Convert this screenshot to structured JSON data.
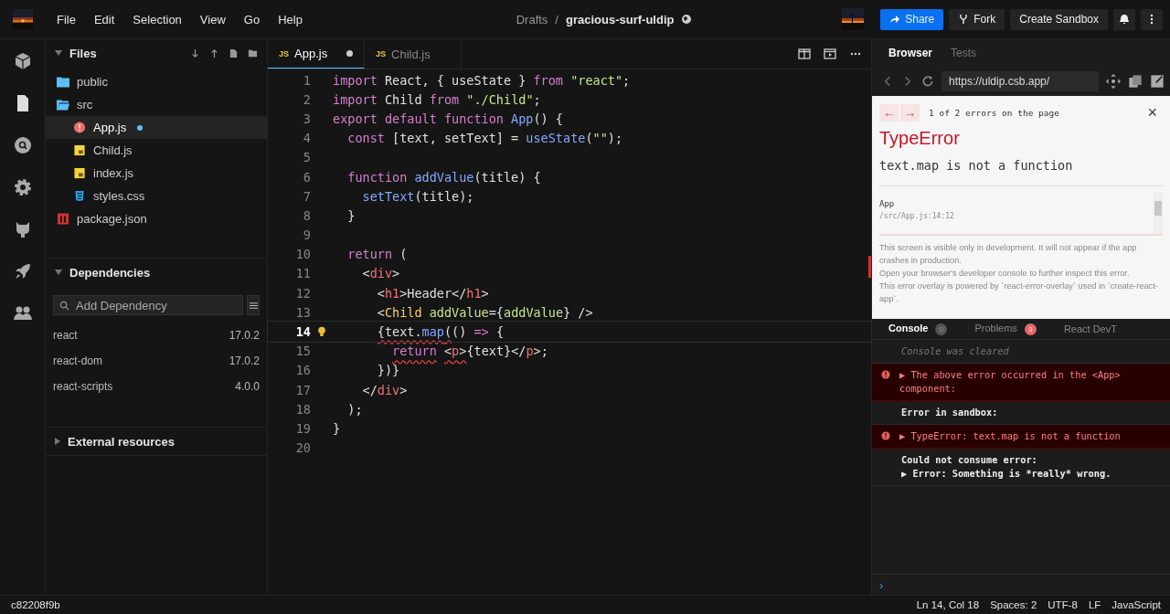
{
  "menu": [
    "File",
    "Edit",
    "Selection",
    "View",
    "Go",
    "Help"
  ],
  "breadcrumb": {
    "folder": "Drafts",
    "separator": "/",
    "name": "gracious-surf-uldip"
  },
  "header_buttons": {
    "share": "Share",
    "fork": "Fork",
    "create": "Create Sandbox"
  },
  "files_panel": {
    "title": "Files",
    "expanded": true
  },
  "files": [
    {
      "name": "public",
      "kind": "folder"
    },
    {
      "name": "src",
      "kind": "folder-open",
      "children": [
        {
          "name": "App.js",
          "kind": "error",
          "selected": true,
          "modified": true
        },
        {
          "name": "Child.js",
          "kind": "js",
          "selected": false,
          "modified": false
        },
        {
          "name": "index.js",
          "kind": "js",
          "selected": false,
          "modified": false
        },
        {
          "name": "styles.css",
          "kind": "css",
          "selected": false,
          "modified": false
        }
      ]
    },
    {
      "name": "package.json",
      "kind": "npm"
    }
  ],
  "dependencies": {
    "title": "Dependencies",
    "expanded": true,
    "placeholder": "Add Dependency",
    "items": [
      {
        "name": "react",
        "version": "17.0.2"
      },
      {
        "name": "react-dom",
        "version": "17.0.2"
      },
      {
        "name": "react-scripts",
        "version": "4.0.0"
      }
    ]
  },
  "external": {
    "title": "External resources",
    "expanded": false
  },
  "editor_tabs": [
    {
      "label": "App.js",
      "badge": "JS",
      "selected": true,
      "modified": true
    },
    {
      "label": "Child.js",
      "badge": "JS",
      "selected": false,
      "modified": false
    }
  ],
  "code": [
    {
      "no": "1",
      "current": false,
      "tokens": [
        {
          "t": "import",
          "kind": "kw"
        },
        {
          "t": " React, { useState } ",
          "kind": "id"
        },
        {
          "t": "from",
          "kind": "kw"
        },
        {
          "t": " \"react\"",
          "kind": "str"
        },
        {
          "t": ";",
          "kind": "id"
        }
      ]
    },
    {
      "no": "2",
      "current": false,
      "tokens": [
        {
          "t": "import",
          "kind": "kw"
        },
        {
          "t": " Child ",
          "kind": "id"
        },
        {
          "t": "from",
          "kind": "kw"
        },
        {
          "t": " \"./Child\"",
          "kind": "str"
        },
        {
          "t": ";",
          "kind": "id"
        }
      ]
    },
    {
      "no": "3",
      "current": false,
      "tokens": [
        {
          "t": "export default function",
          "kind": "kw"
        },
        {
          "t": " App",
          "kind": "fn"
        },
        {
          "t": "() {",
          "kind": "id"
        }
      ]
    },
    {
      "no": "4",
      "current": false,
      "tokens": [
        {
          "t": "  const",
          "kind": "kw"
        },
        {
          "t": " [text, setText] = ",
          "kind": "id"
        },
        {
          "t": "useState",
          "kind": "fn"
        },
        {
          "t": "(",
          "kind": "id"
        },
        {
          "t": "\"\"",
          "kind": "str"
        },
        {
          "t": ");",
          "kind": "id"
        }
      ]
    },
    {
      "no": "5",
      "current": false
    },
    {
      "no": "6",
      "current": false,
      "tokens": [
        {
          "t": "  function",
          "kind": "kw"
        },
        {
          "t": " addValue",
          "kind": "fn"
        },
        {
          "t": "(title) {",
          "kind": "id"
        }
      ]
    },
    {
      "no": "7",
      "current": false,
      "tokens": [
        {
          "t": "    setText",
          "kind": "fn"
        },
        {
          "t": "(title);",
          "kind": "id"
        }
      ]
    },
    {
      "no": "8",
      "current": false,
      "tokens": [
        {
          "t": "  }",
          "kind": "id"
        }
      ]
    },
    {
      "no": "9",
      "current": false
    },
    {
      "no": "10",
      "current": false,
      "tokens": [
        {
          "t": "  return",
          "kind": "kw"
        },
        {
          "t": " (",
          "kind": "id"
        }
      ]
    },
    {
      "no": "11",
      "current": false,
      "tokens": [
        {
          "t": "    <",
          "kind": "id"
        },
        {
          "t": "div",
          "kind": "tag"
        },
        {
          "t": ">",
          "kind": "id"
        }
      ]
    },
    {
      "no": "12",
      "current": false,
      "tokens": [
        {
          "t": "      <",
          "kind": "id"
        },
        {
          "t": "h1",
          "kind": "tag"
        },
        {
          "t": ">Header</",
          "kind": "id"
        },
        {
          "t": "h1",
          "kind": "tag"
        },
        {
          "t": ">",
          "kind": "id"
        }
      ]
    },
    {
      "no": "13",
      "current": false,
      "tokens": [
        {
          "t": "      <",
          "kind": "id"
        },
        {
          "t": "Child",
          "kind": "comp"
        },
        {
          "t": " addValue",
          "kind": "attr"
        },
        {
          "t": "={",
          "kind": "id"
        },
        {
          "t": "addValue",
          "kind": "attr"
        },
        {
          "t": "} />",
          "kind": "id"
        }
      ]
    },
    {
      "no": "14",
      "current": true,
      "tokens": [
        {
          "t": "      {text.",
          "kind": "id",
          "err": true
        },
        {
          "t": "map",
          "kind": "fn",
          "err": true
        },
        {
          "t": "(",
          "kind": "id",
          "err": true
        },
        {
          "t": "() ",
          "kind": "id"
        },
        {
          "t": "=>",
          "kind": "kw"
        },
        {
          "t": " {",
          "kind": "id"
        }
      ]
    },
    {
      "no": "15",
      "current": false,
      "tokens": [
        {
          "t": "        return",
          "kind": "kw",
          "err": true
        },
        {
          "t": " <",
          "kind": "id",
          "err": true
        },
        {
          "t": "p",
          "kind": "tag",
          "err": true
        },
        {
          "t": ">",
          "kind": "id",
          "err": true
        },
        {
          "t": "{text}</",
          "kind": "id"
        },
        {
          "t": "p",
          "kind": "tag"
        },
        {
          "t": ">;",
          "kind": "id"
        }
      ]
    },
    {
      "no": "16",
      "current": false,
      "tokens": [
        {
          "t": "      })}",
          "kind": "id"
        }
      ]
    },
    {
      "no": "17",
      "current": false,
      "tokens": [
        {
          "t": "    </",
          "kind": "id"
        },
        {
          "t": "div",
          "kind": "tag"
        },
        {
          "t": ">",
          "kind": "id"
        }
      ]
    },
    {
      "no": "18",
      "current": false,
      "tokens": [
        {
          "t": "  );",
          "kind": "id"
        }
      ]
    },
    {
      "no": "19",
      "current": false,
      "tokens": [
        {
          "t": "}",
          "kind": "id"
        }
      ]
    },
    {
      "no": "20",
      "current": false
    }
  ],
  "preview_tabs": [
    {
      "label": "Browser",
      "selected": true
    },
    {
      "label": "Tests",
      "selected": false
    }
  ],
  "address": "https://uldip.csb.app/",
  "overlay": {
    "prev": "←",
    "next": "→",
    "count": "1 of 2 errors on the page",
    "close": "×",
    "type": "TypeError",
    "message": "text.map is not a function",
    "frame": "App",
    "location": "/src/App.js:14:12",
    "notes": [
      "This screen is visible only in development. It will not appear if the app crashes in production.",
      "Open your browser's developer console to further inspect this error.",
      "This error overlay is powered by `react-error-overlay` used in `create-react-app`."
    ]
  },
  "console_tabs": [
    {
      "label": "Console",
      "count": "0",
      "selected": true
    },
    {
      "label": "Problems",
      "count": "3",
      "selected": false
    },
    {
      "label": "React DevT",
      "selected": false
    }
  ],
  "console": [
    {
      "kind": "info",
      "text": "Console was cleared"
    },
    {
      "kind": "error",
      "text": "▶ The above error occurred in the <App> component:"
    },
    {
      "kind": "log",
      "text": "Error in sandbox:"
    },
    {
      "kind": "error",
      "text": "▶ TypeError: text.map is not a function"
    },
    {
      "kind": "log",
      "text": "Could not consume error:\n▶ Error: Something is *really* wrong."
    }
  ],
  "prompt": "›",
  "status": {
    "commit": "c82208f9b",
    "position": "Ln 14, Col 18",
    "spaces": "Spaces: 2",
    "encoding": "UTF-8",
    "eol": "LF",
    "language": "JavaScript"
  }
}
